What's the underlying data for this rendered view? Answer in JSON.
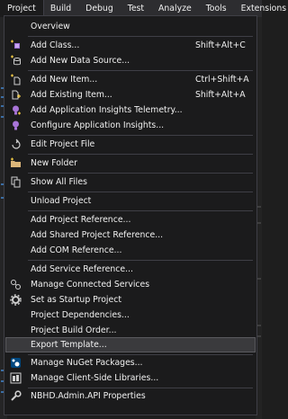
{
  "menubar": {
    "items": [
      "Project",
      "Build",
      "Debug",
      "Test",
      "Analyze",
      "Tools",
      "Extensions"
    ]
  },
  "project_menu": {
    "items": [
      {
        "label": "Overview",
        "shortcut": "",
        "icon": "none"
      },
      {
        "label": "Add Class...",
        "shortcut": "Shift+Alt+C",
        "icon": "add-class-icon"
      },
      {
        "label": "Add New Data Source...",
        "shortcut": "",
        "icon": "data-source-icon"
      },
      {
        "label": "Add New Item...",
        "shortcut": "Ctrl+Shift+A",
        "icon": "new-item-icon"
      },
      {
        "label": "Add Existing Item...",
        "shortcut": "Shift+Alt+A",
        "icon": "existing-item-icon"
      },
      {
        "label": "Add Application Insights Telemetry...",
        "shortcut": "",
        "icon": "app-insights-icon"
      },
      {
        "label": "Configure Application Insights...",
        "shortcut": "",
        "icon": "app-insights-icon"
      },
      {
        "label": "Edit Project File",
        "shortcut": "",
        "icon": "edit-file-icon"
      },
      {
        "label": "New Folder",
        "shortcut": "",
        "icon": "folder-icon"
      },
      {
        "label": "Show All Files",
        "shortcut": "",
        "icon": "show-all-files-icon"
      },
      {
        "label": "Unload Project",
        "shortcut": "",
        "icon": "none"
      },
      {
        "label": "Add Project Reference...",
        "shortcut": "",
        "icon": "none"
      },
      {
        "label": "Add Shared Project Reference...",
        "shortcut": "",
        "icon": "none"
      },
      {
        "label": "Add COM Reference...",
        "shortcut": "",
        "icon": "none"
      },
      {
        "label": "Add Service Reference...",
        "shortcut": "",
        "icon": "none"
      },
      {
        "label": "Manage Connected Services",
        "shortcut": "",
        "icon": "connected-services-icon"
      },
      {
        "label": "Set as Startup Project",
        "shortcut": "",
        "icon": "gear-icon"
      },
      {
        "label": "Project Dependencies...",
        "shortcut": "",
        "icon": "none"
      },
      {
        "label": "Project Build Order...",
        "shortcut": "",
        "icon": "none"
      },
      {
        "label": "Export Template...",
        "shortcut": "",
        "icon": "none",
        "highlighted": true
      },
      {
        "label": "Manage NuGet Packages...",
        "shortcut": "",
        "icon": "nuget-icon"
      },
      {
        "label": "Manage Client-Side Libraries...",
        "shortcut": "",
        "icon": "client-libraries-icon"
      },
      {
        "label": "NBHD.Admin.API Properties",
        "shortcut": "",
        "icon": "wrench-icon"
      }
    ]
  },
  "colors": {
    "menu_bg": "#1b1b1c",
    "menubar_bg": "#2d2d30",
    "border": "#3f3f46",
    "highlight": "#3a3a3d",
    "text": "#f1f1f1"
  }
}
